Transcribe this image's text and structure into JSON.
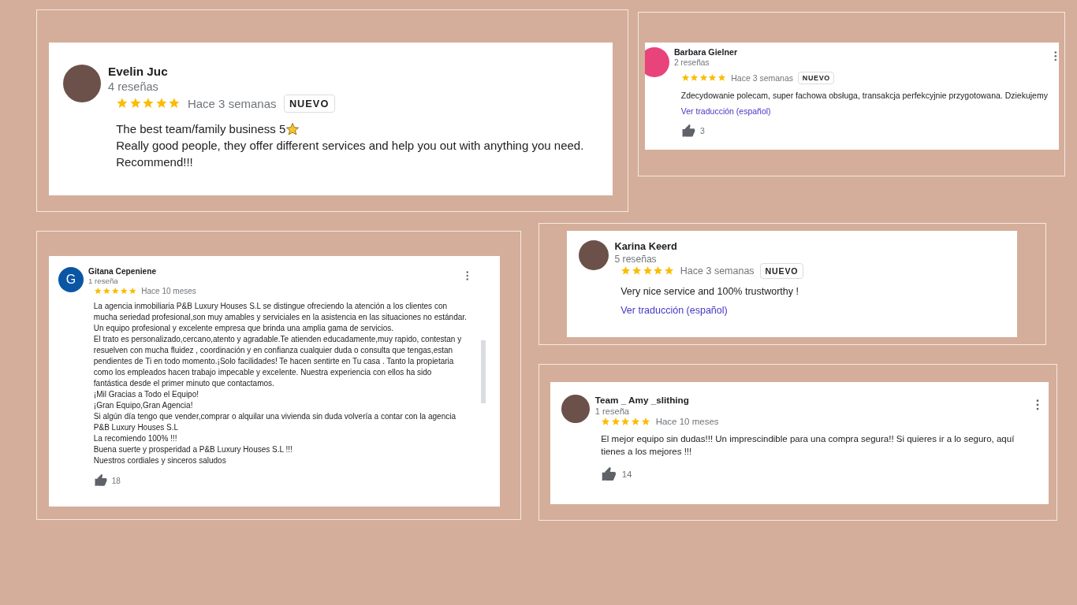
{
  "reviews": [
    {
      "name": "Evelin Juc",
      "count": "4 reseñas",
      "avatar": {
        "kind": "photo"
      },
      "stars": 5,
      "time": "Hace 3 semanas",
      "badge": "NUEVO",
      "body": [
        {
          "text": "The best team/family business 5",
          "star_emoji": true
        },
        {
          "text": "Really good people, they offer different services and help you out with anything you need. Recommend!!!"
        }
      ]
    },
    {
      "name": "Barbara Gielner",
      "count": "2 reseñas",
      "avatar": {
        "kind": "letter",
        "color": "#e8437a"
      },
      "menu_button": true,
      "stars": 5,
      "time": "Hace 3 semanas",
      "badge": "NUEVO",
      "body": [
        {
          "text": "Zdecydowanie polecam, super fachowa obsługa, transakcja perfekcyjnie przygotowana. Dziekujemy"
        }
      ],
      "translate_link": "Ver traducción (español)",
      "likes": "3"
    },
    {
      "name": "Gitana Cepeniene",
      "count": "1 reseña",
      "avatar": {
        "kind": "letter",
        "letter": "G",
        "color": "#0b56a4"
      },
      "menu_button": true,
      "scrollbar": true,
      "stars": 5,
      "time": "Hace 10 meses",
      "body": [
        {
          "text": "La agencia inmobiliaria P&B Luxury Houses S.L se distingue ofreciendo la atención a los clientes con mucha seriedad profesional,son muy amables y serviciales en la asistencia en las situaciones no estándar."
        },
        {
          "text": "Un equipo profesional y excelente empresa que brinda una amplia gama de servicios."
        },
        {
          "text": "El trato es personalizado,cercano,atento y agradable.Te atienden educadamente,muy rapido, contestan y  resuelven con mucha fluidez , coordinación y en confianza cualquier duda o consulta que tengas,estan pendientes de Ti en todo momento.¡Solo facilidades! Te hacen sentirte en Tu casa . Tanto la propietaria como los empleados hacen trabajo impecable y excelente. Nuestra experiencia con ellos ha sido fantástica desde el primer minuto que contactamos."
        },
        {
          "text": "¡Mil Gracias a Todo el Equipo!"
        },
        {
          "text": "¡Gran Equipo,Gran Agencia!"
        },
        {
          "text": "Si algún día tengo que vender,comprar o alquilar una vivienda sin duda volvería a contar con la agencia P&B Luxury Houses S.L"
        },
        {
          "text": "La recomiendo 100% !!!"
        },
        {
          "text": "Buena suerte y prosperidad a P&B Luxury Houses  S.L !!!"
        },
        {
          "text": "Nuestros cordiales y sinceros saludos"
        }
      ],
      "likes": "18"
    },
    {
      "name": "Karina Keerd",
      "count": "5 reseñas",
      "avatar": {
        "kind": "photo"
      },
      "stars": 5,
      "time": "Hace 3 semanas",
      "badge": "NUEVO",
      "body": [
        {
          "text": "Very nice service and 100% trustworthy !"
        }
      ],
      "translate_link": "Ver traducción (español)"
    },
    {
      "name": "Team _ Amy _slithing",
      "count": "1 reseña",
      "avatar": {
        "kind": "photo"
      },
      "menu_button": true,
      "stars": 5,
      "time": "Hace 10 meses",
      "body": [
        {
          "text": "El mejor equipo sin dudas!!! Un imprescindible para una compra segura!! Si quieres ir a lo seguro,  aquí tienes a los mejores !!!"
        }
      ],
      "likes": "14"
    }
  ]
}
